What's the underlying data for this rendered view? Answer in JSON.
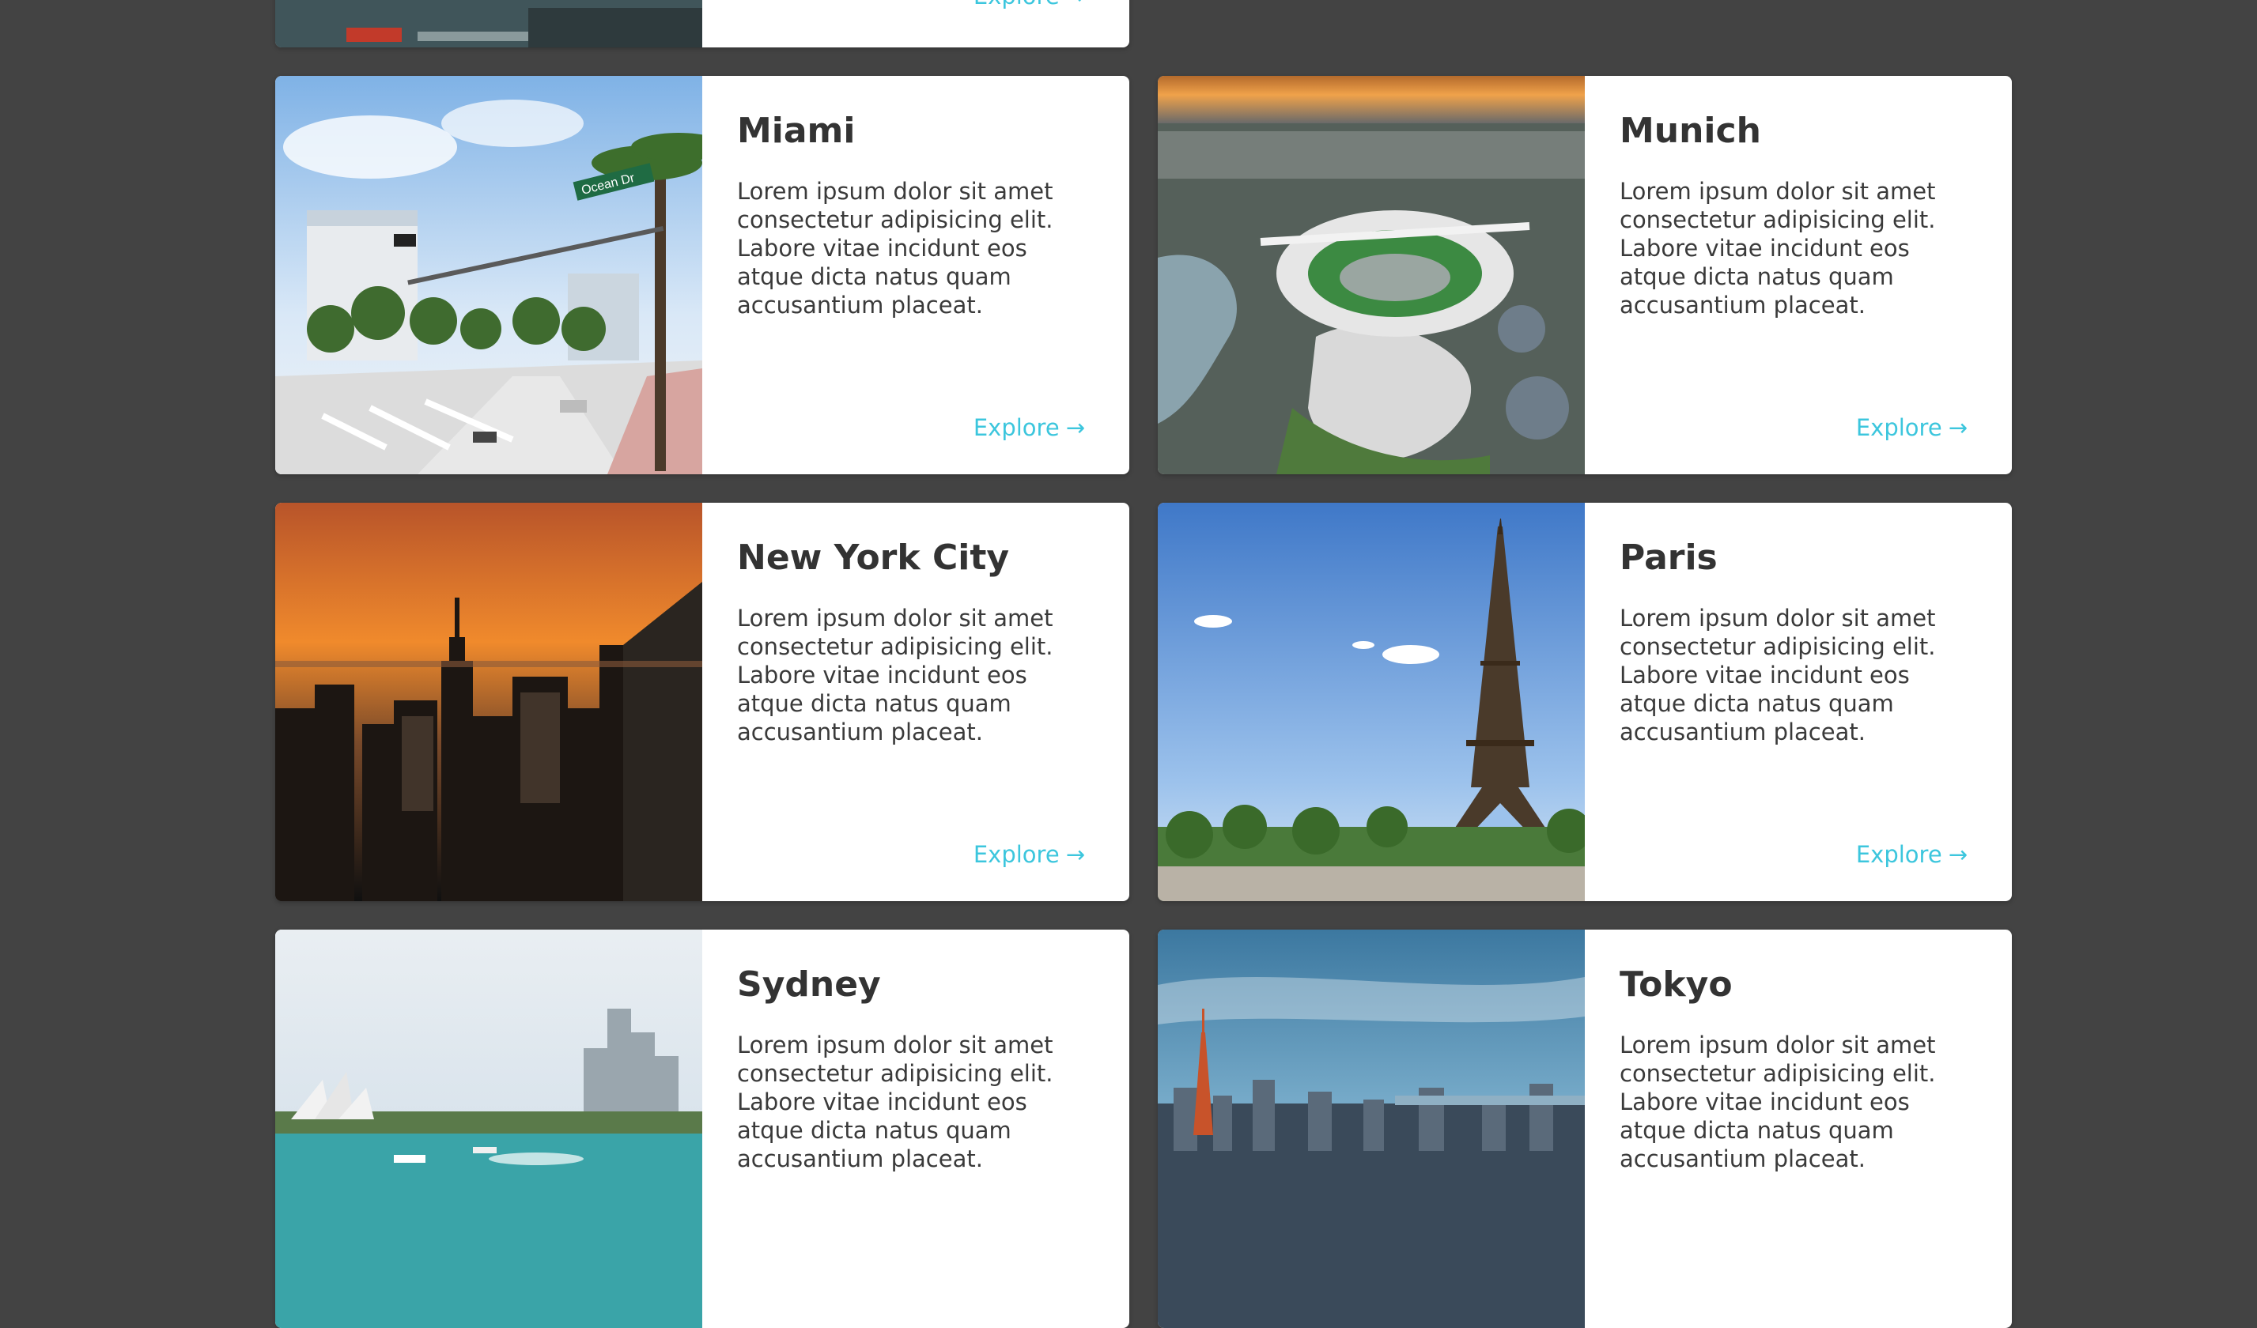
{
  "cards": [
    {
      "title": "",
      "desc": "",
      "explore": "Explore",
      "arrow": "→"
    },
    {
      "title": "",
      "desc": "",
      "explore": "",
      "arrow": ""
    },
    {
      "title": "Miami",
      "desc": "Lorem ipsum dolor sit amet consectetur adipisicing elit. Labore vitae incidunt eos atque dicta natus quam accusantium placeat.",
      "explore": "Explore",
      "arrow": "→",
      "sign": "Ocean Dr"
    },
    {
      "title": "Munich",
      "desc": "Lorem ipsum dolor sit amet consectetur adipisicing elit. Labore vitae incidunt eos atque dicta natus quam accusantium placeat.",
      "explore": "Explore",
      "arrow": "→"
    },
    {
      "title": "New York City",
      "desc": "Lorem ipsum dolor sit amet consectetur adipisicing elit. Labore vitae incidunt eos atque dicta natus quam accusantium placeat.",
      "explore": "Explore",
      "arrow": "→"
    },
    {
      "title": "Paris",
      "desc": "Lorem ipsum dolor sit amet consectetur adipisicing elit. Labore vitae incidunt eos atque dicta natus quam accusantium placeat.",
      "explore": "Explore",
      "arrow": "→"
    },
    {
      "title": "Sydney",
      "desc": "Lorem ipsum dolor sit amet consectetur adipisicing elit. Labore vitae incidunt eos atque dicta natus quam accusantium placeat.",
      "explore": "",
      "arrow": ""
    },
    {
      "title": "Tokyo",
      "desc": "Lorem ipsum dolor sit amet consectetur adipisicing elit. Labore vitae incidunt eos atque dicta natus quam accusantium placeat.",
      "explore": "",
      "arrow": ""
    }
  ],
  "colors": {
    "background": "#434343",
    "card": "#ffffff",
    "title": "#333333",
    "accent": "#3cc6dd"
  }
}
